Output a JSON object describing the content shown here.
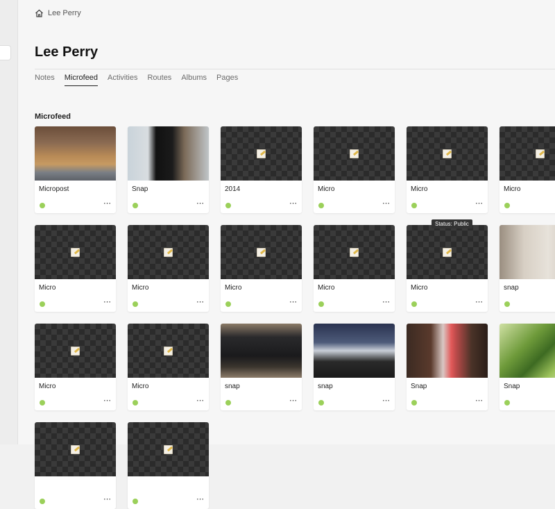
{
  "breadcrumb": {
    "home_icon": "home-icon",
    "label": "Lee Perry"
  },
  "page": {
    "title": "Lee Perry"
  },
  "tabs": [
    {
      "label": "Notes"
    },
    {
      "label": "Microfeed"
    },
    {
      "label": "Activities"
    },
    {
      "label": "Routes"
    },
    {
      "label": "Albums"
    },
    {
      "label": "Pages"
    }
  ],
  "active_tab": "Microfeed",
  "section": {
    "title": "Microfeed"
  },
  "tooltip": {
    "text": "Status: Public"
  },
  "status_color": "#9bd05a",
  "cards": [
    {
      "title": "Micropost",
      "thumb": "photo-dog-on-bed"
    },
    {
      "title": "Snap",
      "thumb": "photo-man-with-dog"
    },
    {
      "title": "2014",
      "thumb": "placeholder"
    },
    {
      "title": "Micro",
      "thumb": "placeholder"
    },
    {
      "title": "Micro",
      "thumb": "placeholder"
    },
    {
      "title": "Micro",
      "thumb": "placeholder"
    },
    {
      "title": "Micro",
      "thumb": "placeholder"
    },
    {
      "title": "Micro",
      "thumb": "placeholder"
    },
    {
      "title": "Micro",
      "thumb": "placeholder"
    },
    {
      "title": "Micro",
      "thumb": "placeholder"
    },
    {
      "title": "Micro",
      "thumb": "placeholder"
    },
    {
      "title": "snap",
      "thumb": "photo-door"
    },
    {
      "title": "Micro",
      "thumb": "placeholder"
    },
    {
      "title": "Micro",
      "thumb": "placeholder"
    },
    {
      "title": "snap",
      "thumb": "photo-black-dogs"
    },
    {
      "title": "snap",
      "thumb": "photo-dog-sleeping"
    },
    {
      "title": "Snap",
      "thumb": "photo-bottle"
    },
    {
      "title": "Snap",
      "thumb": "photo-broccoli"
    },
    {
      "title": "",
      "thumb": "placeholder"
    },
    {
      "title": "",
      "thumb": "placeholder"
    }
  ]
}
